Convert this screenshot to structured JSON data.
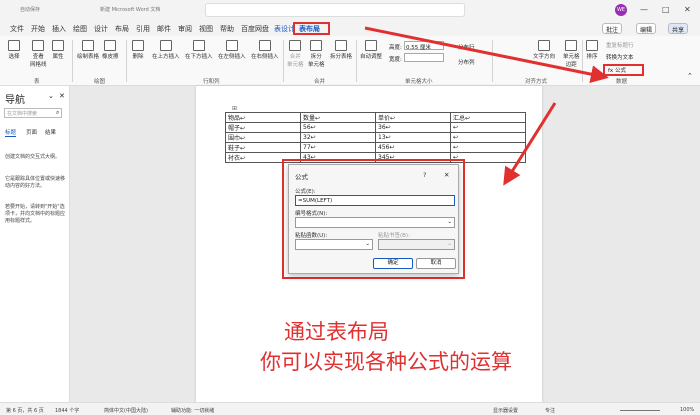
{
  "titlebar": {
    "autosave": "自动保存",
    "doc_title": "新建 Microsoft Word 文档",
    "avatar_initials": "WE",
    "minimize_glyph": "—",
    "maximize_glyph": "□",
    "close_glyph": "✕"
  },
  "tabs": [
    "文件",
    "开始",
    "插入",
    "绘图",
    "设计",
    "布局",
    "引用",
    "邮件",
    "审阅",
    "视图",
    "帮助",
    "百度网盘",
    "表设计",
    "表布局"
  ],
  "ribbon_right": {
    "comment": "批注",
    "edit": "编辑",
    "share": "共享"
  },
  "ribbon": {
    "select": "选择",
    "gridlines": "查看\n网格线",
    "properties": "属性",
    "draw_table": "绘制表格",
    "eraser": "橡皮擦",
    "delete": "删除",
    "insert_above": "在上方插入",
    "insert_below": "在下方插入",
    "insert_left": "在左侧插入",
    "insert_right": "在右侧插入",
    "merge_cells": "合并\n单元格",
    "split_cells": "拆分\n单元格",
    "split_table": "拆分表格",
    "autofit": "自动调整",
    "height_label": "高度:",
    "height_value": "0.55 厘米",
    "width_label": "宽度:",
    "width_value": "",
    "distribute_rows": "分布行",
    "distribute_cols": "分布列",
    "text_direction": "文字方向",
    "cell_margins": "单元格\n边距",
    "sort": "排序",
    "repeat_header": "重复标题行",
    "convert_to_text": "转换为文本",
    "formula": "fx 公式",
    "groups": {
      "table": "表",
      "draw": "绘图",
      "rows_cols": "行和列",
      "merge": "合并",
      "cell_size": "单元格大小",
      "alignment": "对齐方式",
      "data": "数据"
    }
  },
  "nav": {
    "title": "导航",
    "search_placeholder": "在文档中搜索",
    "tabs": [
      "标题",
      "页面",
      "结果"
    ],
    "text1": "创建文档的交互式大纲。",
    "text2": "它是跟踪具体位置或快速移动内容的好方法。",
    "text3": "若要开始，请转到\"开始\"选项卡，并向文档中的标题应用标题样式。"
  },
  "doc_table": {
    "rows": [
      [
        "物品↩",
        "数量↩",
        "单价↩",
        "汇总↩"
      ],
      [
        "帽子↩",
        "56↩",
        "36↩",
        "↩"
      ],
      [
        "围巾↩",
        "32↩",
        "13↩",
        "↩"
      ],
      [
        "鞋子↩",
        "77↩",
        "456↩",
        "↩"
      ],
      [
        "衬衣↩",
        "43↩",
        "345↩",
        "↩"
      ]
    ]
  },
  "dialog": {
    "title": "公式",
    "help": "?",
    "close": "✕",
    "formula_label": "公式(E):",
    "formula_value": "=SUM(LEFT)",
    "format_label": "编号格式(N):",
    "paste_function_label": "粘贴函数(U):",
    "paste_bookmark_label": "粘贴书签(B):",
    "ok": "确定",
    "cancel": "取消"
  },
  "overlay": {
    "line1": "通过表布局",
    "line2": "你可以实现各种公式的运算"
  },
  "status": {
    "page": "第 6 页，共 6 页",
    "words": "1844 个字",
    "language": "简体中文(中国大陆)",
    "accessibility": "辅助功能: 一切就绪",
    "display": "显示器设置",
    "focus": "专注",
    "zoom": "100%"
  },
  "colors": {
    "accent": "#185abd",
    "highlight": "#e03030"
  }
}
